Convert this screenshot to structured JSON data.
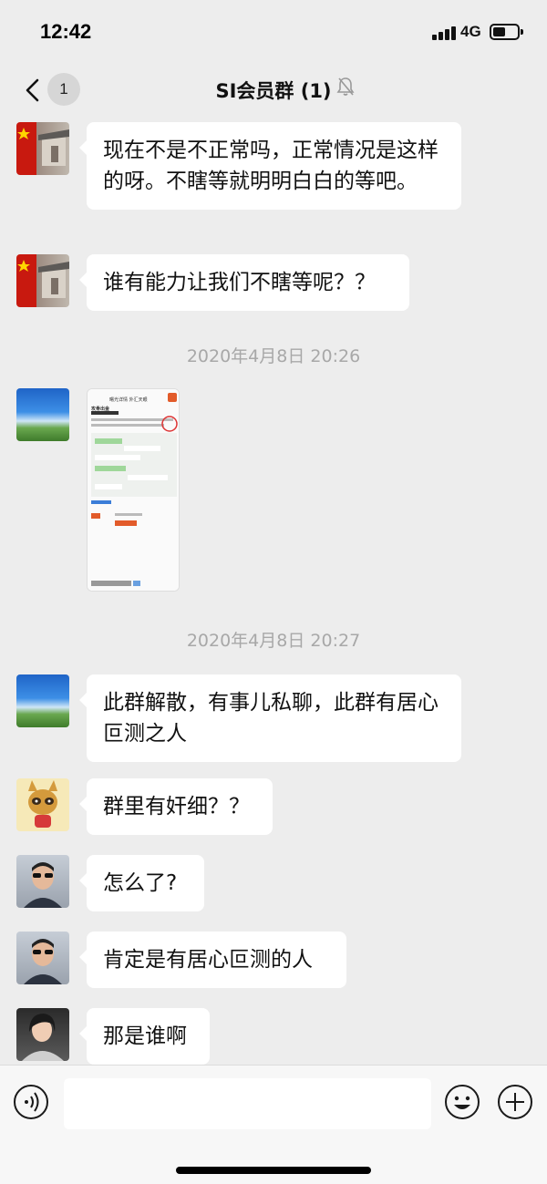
{
  "status_bar": {
    "time": "12:42",
    "network": "4G"
  },
  "header": {
    "back_badge": "1",
    "title": "SI会员群 (1)",
    "icons": [
      "chevron-left-icon",
      "bell-muted-icon"
    ]
  },
  "messages": [
    {
      "type": "text",
      "avatar": "flag-avatar",
      "text": "现在不是不正常吗，正常情况是这样的呀。不瞎等就明明白白的等吧。"
    },
    {
      "type": "text",
      "avatar": "flag-avatar",
      "text": "谁有能力让我们不瞎等呢？？"
    },
    {
      "type": "timestamp",
      "text": "2020年4月8日 20:26"
    },
    {
      "type": "image",
      "avatar": "sky-avatar",
      "thumb": {
        "title": "曙光详情 外汇天眼",
        "heading": "攻骨出金"
      }
    },
    {
      "type": "timestamp",
      "text": "2020年4月8日 20:27"
    },
    {
      "type": "text",
      "avatar": "sky-avatar",
      "text": "此群解散，有事儿私聊，此群有居心叵测之人"
    },
    {
      "type": "text",
      "avatar": "raccoon-avatar",
      "text": "群里有奸细？？"
    },
    {
      "type": "text",
      "avatar": "man-avatar",
      "text": "怎么了?"
    },
    {
      "type": "text",
      "avatar": "man-avatar",
      "text": "肯定是有居心叵测的人"
    },
    {
      "type": "text",
      "avatar": "woman-avatar",
      "text": "那是谁啊"
    }
  ],
  "input_bar": {
    "icons": [
      "voice-icon",
      "emoji-icon",
      "plus-icon"
    ],
    "value": ""
  }
}
